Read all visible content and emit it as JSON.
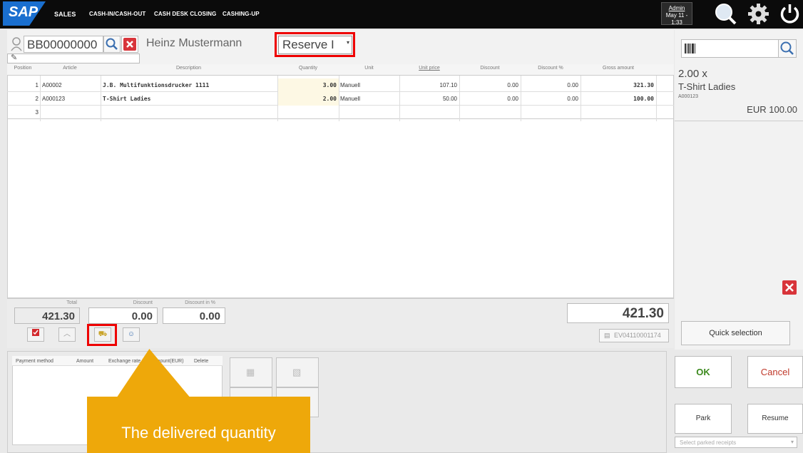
{
  "app": {
    "logo": "SAP"
  },
  "nav": {
    "items": [
      "SALES",
      "CASH-IN/CASH-OUT",
      "CASH DESK CLOSING",
      "CASHING-UP"
    ]
  },
  "admin": {
    "user": "Admin",
    "time": "May 11 - 1:33",
    "extra": "..."
  },
  "customer": {
    "id": "BB00000000",
    "name": "Heinz Mustermann",
    "reserve": "Reserve I"
  },
  "table": {
    "headers": [
      "Position",
      "Article",
      "Description",
      "Quantity",
      "Unit",
      "Unit price",
      "Discount",
      "Discount %",
      "Gross amount"
    ],
    "rows": [
      {
        "pos": "1",
        "article": "A00002",
        "desc": "J.B. Multifunktionsdrucker 1111",
        "qty": "3.00",
        "unit": "Manuell",
        "price": "107.10",
        "disc": "0.00",
        "discpct": "0.00",
        "gross": "321.30"
      },
      {
        "pos": "2",
        "article": "A000123",
        "desc": "T-Shirt Ladies",
        "qty": "2.00",
        "unit": "Manuell",
        "price": "50.00",
        "disc": "0.00",
        "discpct": "0.00",
        "gross": "100.00"
      },
      {
        "pos": "3",
        "article": "",
        "desc": "",
        "qty": "",
        "unit": "",
        "price": "",
        "disc": "",
        "discpct": "",
        "gross": ""
      }
    ]
  },
  "detail": {
    "qty": "2.00 x",
    "name": "T-Shirt Ladies",
    "article": "A000123",
    "amount": "EUR 100.00"
  },
  "totals": {
    "total_label": "Total",
    "total": "421.30",
    "discount_label": "Discount",
    "discount": "0.00",
    "discpct_label": "Discount in %",
    "discpct": "0.00",
    "grand": "421.30",
    "receipt": "EV04110001174"
  },
  "payment": {
    "headers": [
      "Payment method",
      "Amount",
      "Exchange rate",
      "Amount(EUR)",
      "Delete"
    ]
  },
  "buttons": {
    "quick": "Quick selection",
    "ok": "OK",
    "cancel": "Cancel",
    "park": "Park",
    "resume": "Resume",
    "parked_placeholder": "Select parked receipts"
  },
  "callout": {
    "text": "The delivered quantity"
  },
  "colors": {
    "accent": "#1a6fcf",
    "highlight": "#e00000",
    "callout": "#eea80a",
    "ok": "#3c8a1e",
    "cancel": "#c0392b"
  }
}
